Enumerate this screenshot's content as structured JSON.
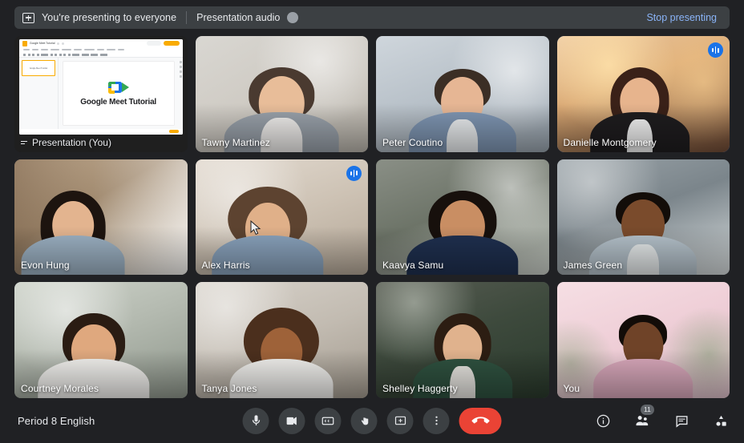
{
  "app": {
    "name": "Google Meet"
  },
  "present_bar": {
    "icon": "present-screen-icon",
    "status_text": "You're presenting to everyone",
    "audio_label": "Presentation audio",
    "audio_toggle_state": "off",
    "stop_label": "Stop presenting",
    "stop_color": "#8ab4f8",
    "background": "#3c4043"
  },
  "slides": {
    "doc_title": "Google Meet Tutorial",
    "slide_title": "Google Meet Tutorial",
    "thumb_label": "Google Meet Tutorial",
    "logo": "google-meet-logo",
    "share_label": "Share",
    "slideshow_label": "Slideshow"
  },
  "grid": {
    "active_border_color": "#4285f4",
    "speaking_badge_color": "#1a73e8",
    "tiles": [
      {
        "name": "Presentation (You)",
        "type": "presentation",
        "speaking": false,
        "active": false
      },
      {
        "name": "Tawny Martinez",
        "type": "video",
        "speaking": false,
        "active": false
      },
      {
        "name": "Peter Coutino",
        "type": "video",
        "speaking": false,
        "active": false
      },
      {
        "name": "Danielle Montgomery",
        "type": "video",
        "speaking": true,
        "active": true
      },
      {
        "name": "Evon Hung",
        "type": "video",
        "speaking": false,
        "active": false
      },
      {
        "name": "Alex Harris",
        "type": "video",
        "speaking": true,
        "active": false
      },
      {
        "name": "Kaavya Samu",
        "type": "video",
        "speaking": false,
        "active": false
      },
      {
        "name": "James Green",
        "type": "video",
        "speaking": false,
        "active": false
      },
      {
        "name": "Courtney Morales",
        "type": "video",
        "speaking": false,
        "active": false
      },
      {
        "name": "Tanya Jones",
        "type": "video",
        "speaking": false,
        "active": false
      },
      {
        "name": "Shelley Haggerty",
        "type": "video",
        "speaking": false,
        "active": false
      },
      {
        "name": "You",
        "type": "video",
        "speaking": false,
        "active": false
      }
    ]
  },
  "bottom_bar": {
    "meeting_name": "Period 8 English",
    "controls": [
      {
        "id": "microphone",
        "icon": "microphone-icon",
        "label": "Turn off microphone"
      },
      {
        "id": "camera",
        "icon": "video-camera-icon",
        "label": "Turn off camera"
      },
      {
        "id": "captions",
        "icon": "closed-captions-icon",
        "label": "Turn on captions"
      },
      {
        "id": "raise-hand",
        "icon": "raise-hand-icon",
        "label": "Raise hand"
      },
      {
        "id": "present",
        "icon": "present-screen-icon",
        "label": "Present now"
      },
      {
        "id": "more-options",
        "icon": "more-vertical-icon",
        "label": "More options"
      },
      {
        "id": "leave-call",
        "icon": "phone-hangup-icon",
        "label": "Leave call",
        "color": "#ea4335"
      }
    ],
    "right_controls": [
      {
        "id": "meeting-details",
        "icon": "info-icon",
        "label": "Meeting details"
      },
      {
        "id": "people",
        "icon": "people-icon",
        "label": "Show everyone",
        "badge": "11"
      },
      {
        "id": "chat",
        "icon": "chat-icon",
        "label": "Chat with everyone"
      },
      {
        "id": "activities",
        "icon": "activities-icon",
        "label": "Activities"
      }
    ]
  }
}
